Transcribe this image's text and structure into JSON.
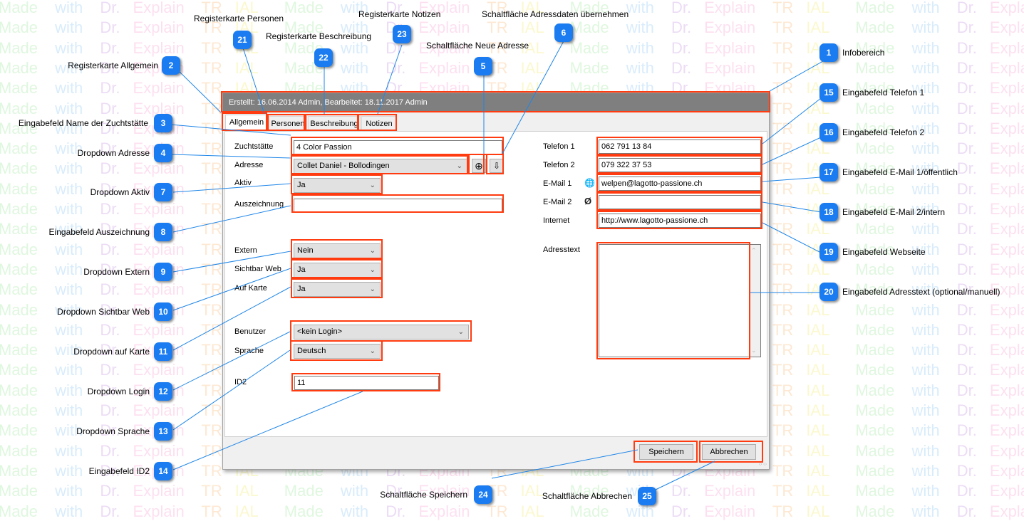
{
  "watermark": "Made with Dr.Explain TRIAL",
  "dialog": {
    "info_text": "Erstellt: 16.06.2014 Admin, Bearbeitet: 18.11.2017 Admin",
    "tabs": [
      {
        "label": "Allgemein",
        "active": true
      },
      {
        "label": "Personen",
        "active": false
      },
      {
        "label": "Beschreibung",
        "active": false
      },
      {
        "label": "Notizen",
        "active": false
      }
    ],
    "left": {
      "zuchtstaette": {
        "label": "Zuchtstätte",
        "value": "4 Color Passion"
      },
      "adresse": {
        "label": "Adresse",
        "value": "Collet Daniel - Bollodingen"
      },
      "aktiv": {
        "label": "Aktiv",
        "value": "Ja"
      },
      "auszeichnung": {
        "label": "Auszeichnung",
        "value": ""
      },
      "extern": {
        "label": "Extern",
        "value": "Nein"
      },
      "sichtbar_web": {
        "label": "Sichtbar Web",
        "value": "Ja"
      },
      "auf_karte": {
        "label": "Auf Karte",
        "value": "Ja"
      },
      "benutzer": {
        "label": "Benutzer",
        "value": "<kein Login>"
      },
      "sprache": {
        "label": "Sprache",
        "value": "Deutsch"
      },
      "id2": {
        "label": "ID2",
        "value": "11"
      }
    },
    "right": {
      "telefon1": {
        "label": "Telefon 1",
        "value": "062 791 13 84"
      },
      "telefon2": {
        "label": "Telefon 2",
        "value": "079 322 37 53"
      },
      "email1": {
        "label": "E-Mail 1",
        "value": "welpen@lagotto-passione.ch",
        "icon": "globe-icon"
      },
      "email2": {
        "label": "E-Mail 2",
        "value": "",
        "icon": "no-globe-icon"
      },
      "internet": {
        "label": "Internet",
        "value": "http://www.lagotto-passione.ch"
      },
      "adresstext": {
        "label": "Adresstext",
        "value": ""
      }
    },
    "icons": {
      "new_address": "⊕",
      "take_address": "⇩"
    },
    "buttons": {
      "save": "Speichern",
      "cancel": "Abbrechen"
    }
  },
  "annotations": [
    {
      "n": "1",
      "text": "Infobereich"
    },
    {
      "n": "2",
      "text": "Registerkarte Allgemein"
    },
    {
      "n": "3",
      "text": "Eingabefeld Name der Zuchtstätte"
    },
    {
      "n": "4",
      "text": "Dropdown Adresse"
    },
    {
      "n": "5",
      "text": "Schaltfläche Neue Adresse"
    },
    {
      "n": "6",
      "text": "Schaltfläche Adressdaten übernehmen"
    },
    {
      "n": "7",
      "text": "Dropdown Aktiv"
    },
    {
      "n": "8",
      "text": "Eingabefeld Auszeichnung"
    },
    {
      "n": "9",
      "text": "Dropdown Extern"
    },
    {
      "n": "10",
      "text": "Dropdown Sichtbar Web"
    },
    {
      "n": "11",
      "text": "Dropdown auf Karte"
    },
    {
      "n": "12",
      "text": "Dropdown Login"
    },
    {
      "n": "13",
      "text": "Dropdown Sprache"
    },
    {
      "n": "14",
      "text": "Eingabefeld ID2"
    },
    {
      "n": "15",
      "text": "Eingabefeld Telefon 1"
    },
    {
      "n": "16",
      "text": "Eingabefeld Telefon 2"
    },
    {
      "n": "17",
      "text": "Eingabefeld E-Mail 1/öffentlich"
    },
    {
      "n": "18",
      "text": "Eingabefeld E-Mail 2/intern"
    },
    {
      "n": "19",
      "text": "Eingabefeld Webseite"
    },
    {
      "n": "20",
      "text": "Eingabefeld Adresstext (optional/manuell)"
    },
    {
      "n": "21",
      "text": "Registerkarte Personen"
    },
    {
      "n": "22",
      "text": "Registerkarte Beschreibung"
    },
    {
      "n": "23",
      "text": "Registerkarte Notizen"
    },
    {
      "n": "24",
      "text": "Schaltfläche Speichern"
    },
    {
      "n": "25",
      "text": "Schaltfläche Abbrechen"
    }
  ]
}
